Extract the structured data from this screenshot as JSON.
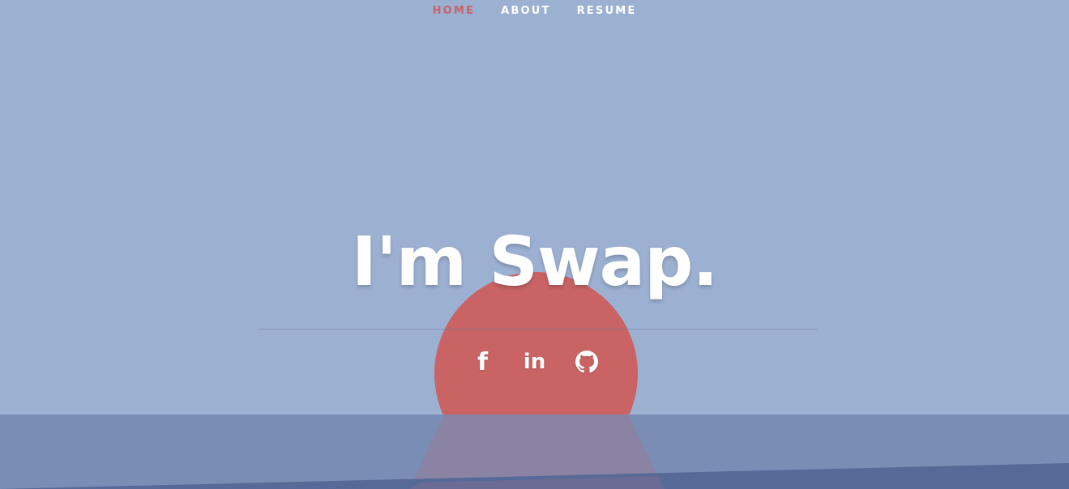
{
  "nav": {
    "items": [
      {
        "label": "HOME",
        "active": true
      },
      {
        "label": "ABOUT",
        "active": false
      },
      {
        "label": "RESUME",
        "active": false
      }
    ]
  },
  "hero": {
    "title": "I'm Swap."
  },
  "social": {
    "facebook_glyph": "f",
    "linkedin_glyph": "in",
    "icons": [
      "facebook-icon",
      "linkedin-icon",
      "github-icon"
    ]
  },
  "colors": {
    "sky": "#9cb0d2",
    "sun": "#c96364",
    "sea": "#7a8db4",
    "active_nav": "#cb6363",
    "text": "#ffffff"
  }
}
